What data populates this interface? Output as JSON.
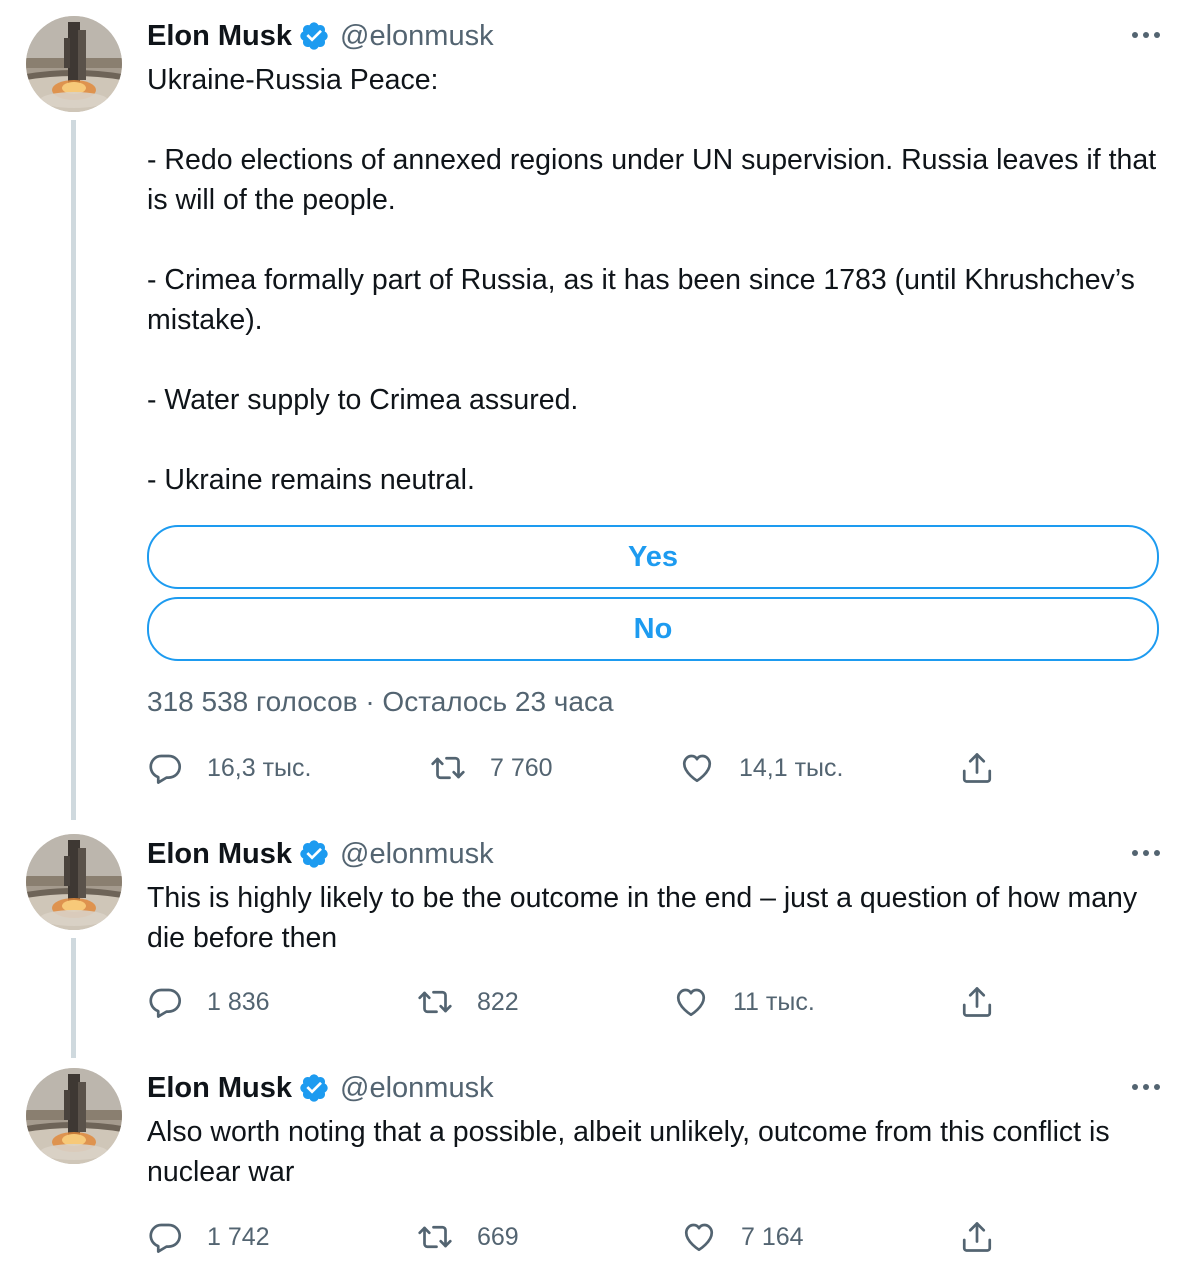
{
  "tweets": [
    {
      "name": "Elon Musk",
      "handle": "@elonmusk",
      "text": "Ukraine-Russia Peace:\n\n- Redo elections of annexed regions under UN supervision. Russia leaves if that is will of the people.\n\n- Crimea formally part of Russia, as it has been since 1783 (until Khrushchev’s mistake).\n\n- Water supply to Crimea assured.\n\n- Ukraine remains neutral.",
      "poll": {
        "options": [
          "Yes",
          "No"
        ],
        "meta": "318 538 голосов · Осталось 23 часа"
      },
      "replies": "16,3 тыс.",
      "retweets": "7 760",
      "likes": "14,1 тыс."
    },
    {
      "name": "Elon Musk",
      "handle": "@elonmusk",
      "text": "This is highly likely to be the outcome in the end – just a question of how many die before then",
      "replies": "1 836",
      "retweets": "822",
      "likes": "11 тыс."
    },
    {
      "name": "Elon Musk",
      "handle": "@elonmusk",
      "text": "Also worth noting that a possible, albeit unlikely, outcome from this conflict is nuclear war",
      "replies": "1 742",
      "retweets": "669",
      "likes": "7 164"
    }
  ],
  "colors": {
    "accent": "#1d9bf0",
    "secondary_text": "#536471",
    "thread_line": "#cfd9de"
  },
  "icons": [
    "verified-badge-icon",
    "more-icon",
    "reply-icon",
    "retweet-icon",
    "like-icon",
    "share-icon"
  ]
}
